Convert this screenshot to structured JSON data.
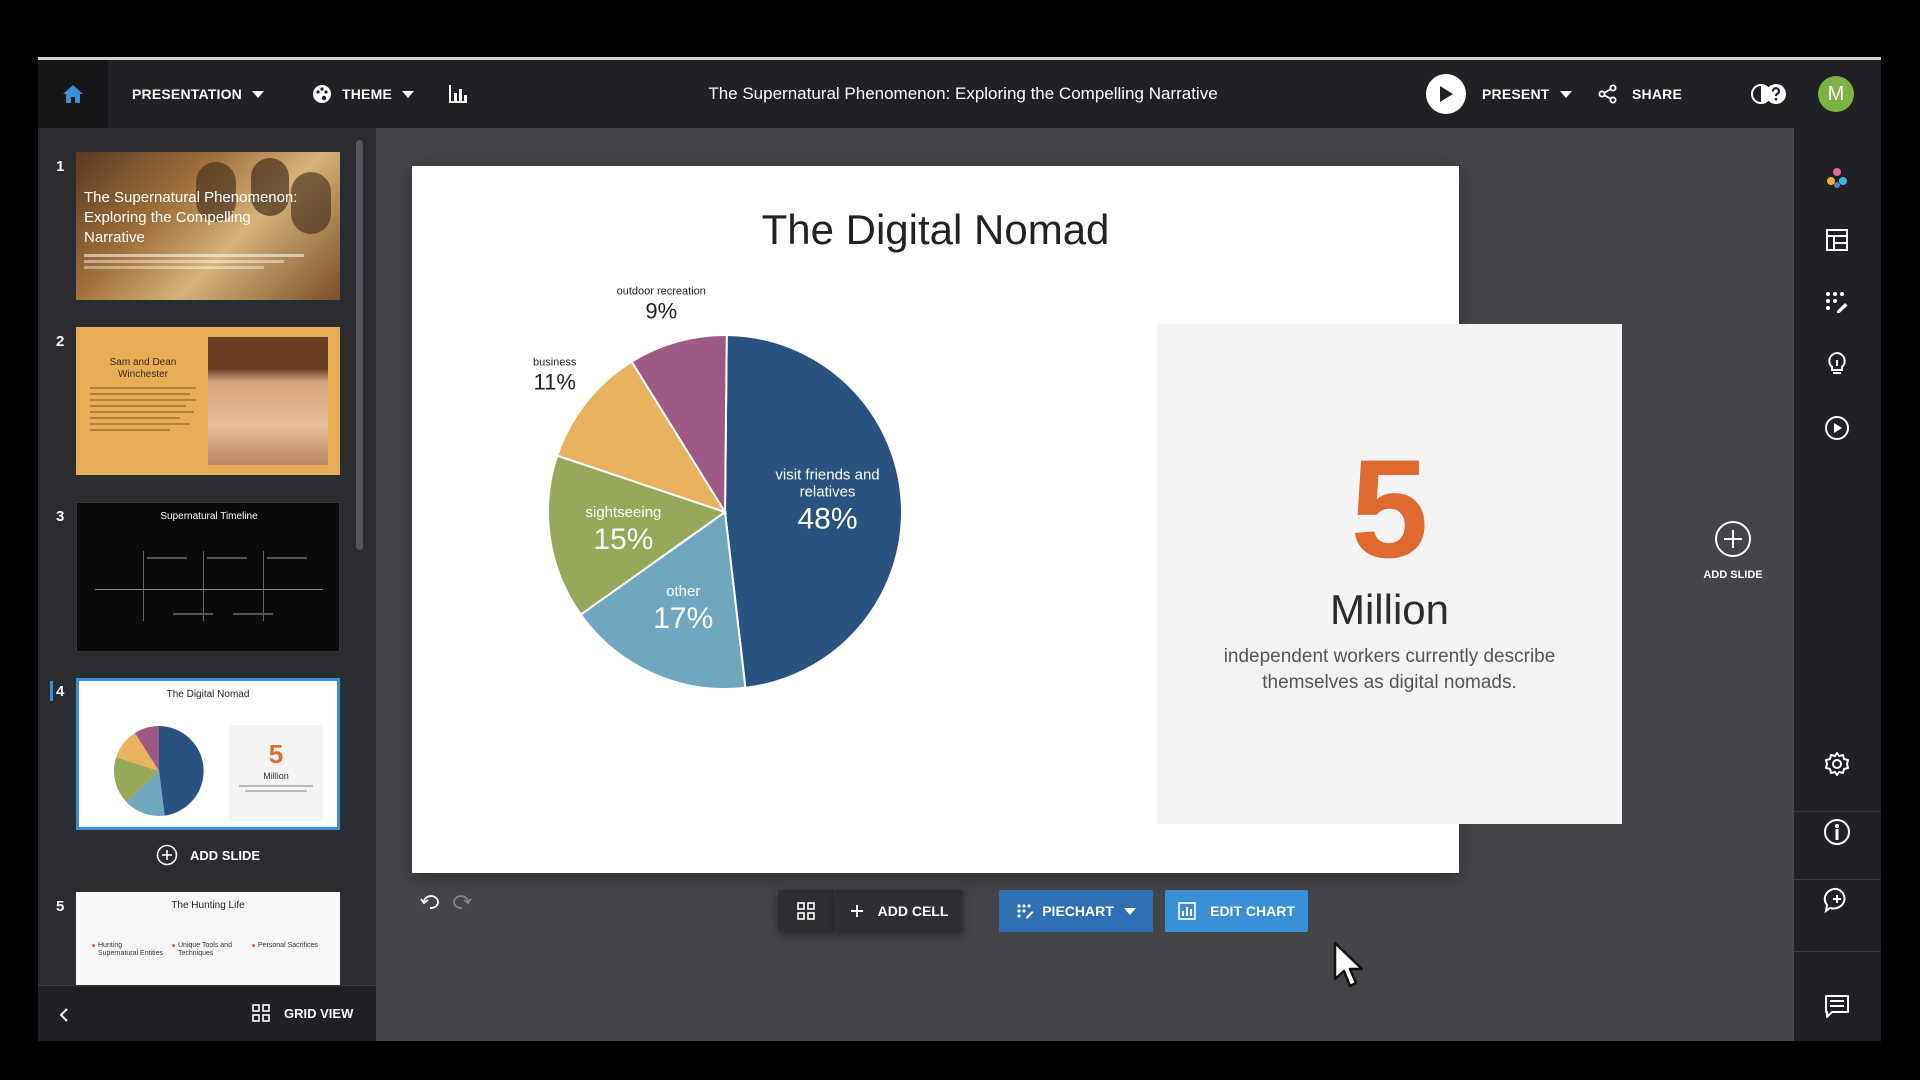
{
  "topbar": {
    "presentation_label": "PRESENTATION",
    "theme_label": "THEME",
    "title": "The Supernatural Phenomenon: Exploring the Compelling Narrative",
    "present_label": "PRESENT",
    "share_label": "SHARE",
    "avatar_initial": "M"
  },
  "sidebar": {
    "thumbnails": [
      {
        "number": "1",
        "title": "The Supernatural Phenomenon: Exploring the Compelling Narrative"
      },
      {
        "number": "2",
        "title": "Sam and Dean Winchester"
      },
      {
        "number": "3",
        "title": "Supernatural Timeline"
      },
      {
        "number": "4",
        "title": "The Digital Nomad",
        "stat_number": "5",
        "stat_unit": "Million"
      },
      {
        "number": "5",
        "title": "The Hunting Life",
        "bullets": [
          "Hunting Supernatural Entities",
          "Unique Tools and Techniques",
          "Personal Sacrifices"
        ]
      }
    ],
    "add_slide_label": "ADD SLIDE",
    "grid_view_label": "GRID VIEW"
  },
  "slide": {
    "title": "The Digital Nomad",
    "stat_number": "5",
    "stat_unit": "Million",
    "stat_description": "independent workers currently describe themselves as digital nomads."
  },
  "chart_data": {
    "type": "pie",
    "title": "",
    "slices": [
      {
        "label": "visit friends and relatives",
        "pct_label": "48%",
        "value": 48,
        "color": "#2a527f"
      },
      {
        "label": "other",
        "pct_label": "17%",
        "value": 17,
        "color": "#70a7bf"
      },
      {
        "label": "sightseeing",
        "pct_label": "15%",
        "value": 15,
        "color": "#98a85a"
      },
      {
        "label": "business",
        "pct_label": "11%",
        "value": 11,
        "color": "#e9b25f"
      },
      {
        "label": "outdoor recreation",
        "pct_label": "9%",
        "value": 9,
        "color": "#9d5a84"
      }
    ]
  },
  "toolbar": {
    "add_cell_label": "ADD CELL",
    "piechart_label": "PIECHART",
    "edit_chart_label": "EDIT CHART"
  },
  "rightrail": {
    "add_slide_label": "ADD SLIDE"
  },
  "colors": {
    "accent_blue": "#3b8fd6",
    "toolbar_blue": "#2f6fb3",
    "stat_orange": "#de6a2f"
  }
}
